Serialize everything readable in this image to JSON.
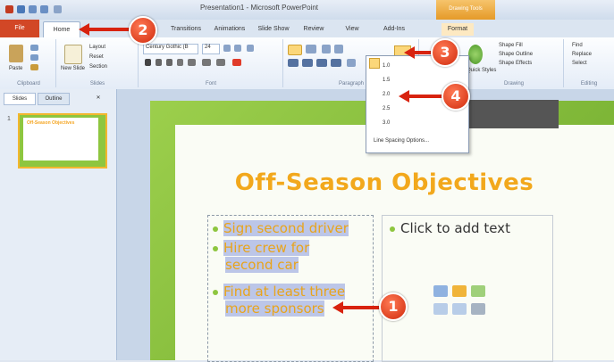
{
  "window": {
    "title": "Presentation1 - Microsoft PowerPoint",
    "context_tab_group": "Drawing Tools"
  },
  "tabs": {
    "file": "File",
    "home": "Home",
    "items": [
      "Transitions",
      "Animations",
      "Slide Show",
      "Review",
      "View",
      "Add-Ins",
      "Format"
    ]
  },
  "ribbon": {
    "clipboard": {
      "paste": "Paste",
      "label": "Clipboard"
    },
    "slides": {
      "new_slide": "New Slide",
      "layout": "Layout",
      "reset": "Reset",
      "section": "Section",
      "label": "Slides"
    },
    "font": {
      "name": "Century Gothic (B",
      "size": "24",
      "label": "Font"
    },
    "paragraph": {
      "label": "Paragraph"
    },
    "drawing": {
      "shape_fill": "Shape Fill",
      "shape_outline": "Shape Outline",
      "shape_effects": "Shape Effects",
      "quick_styles": "Quick Styles",
      "label": "Drawing"
    },
    "editing": {
      "find": "Find",
      "replace": "Replace",
      "select": "Select",
      "label": "Editing"
    }
  },
  "line_spacing_menu": {
    "options": [
      "1.0",
      "1.5",
      "2.0",
      "2.5",
      "3.0"
    ],
    "checked_value": "1.0",
    "more": "Line Spacing Options..."
  },
  "slides_pane": {
    "tabs": [
      "Slides",
      "Outline"
    ],
    "thumbnail_number": "1",
    "thumbnail_title": "Off-Season Objectives"
  },
  "slide": {
    "title": "Off-Season Objectives",
    "bullets": [
      [
        "Sign second driver"
      ],
      [
        "Hire crew for",
        "second car"
      ],
      [
        "Find at least three",
        "more sponsors"
      ]
    ],
    "placeholder": "Click to add text"
  },
  "callouts": [
    "2",
    "3",
    "4",
    "1"
  ],
  "colors": {
    "accent_orange": "#f2a81c",
    "slide_green": "#8ec63f",
    "callout_red": "#d8230f",
    "file_tab": "#d24726",
    "selection_highlight": "#bcc6e8"
  }
}
